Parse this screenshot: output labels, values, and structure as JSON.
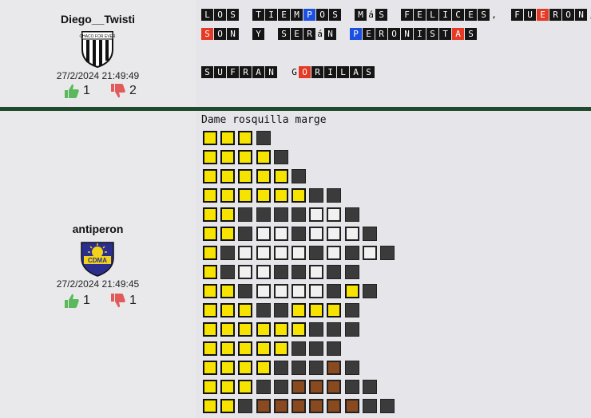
{
  "posts": [
    {
      "username": "Diego__Twisti",
      "badge_text": "CHACO FOR EVER",
      "date": "27/2/2024 21:49:49",
      "likes": "1",
      "dislikes": "2",
      "message_lines": [
        "LOS TIEMPOS MáS FELICES, FUERON,",
        "SON Y SERáN PERONISTAS",
        "",
        "SUFRAN GORILAS"
      ],
      "blue_letters": [
        "P",
        "P"
      ],
      "red_letters": [
        "O",
        "S",
        "A",
        "O"
      ]
    },
    {
      "username": "antiperon",
      "badge_text": "CDMA",
      "date": "27/2/2024 21:49:45",
      "likes": "1",
      "dislikes": "1",
      "caption": "Dame rosquilla marge",
      "art_rows": [
        "yyyd",
        "yyyyd",
        "yyyyyd",
        "yyyyyydd",
        "yyddddwwd",
        "yydwwdwwwd",
        "ydwwwwdwdwd",
        "ydwwddwdd",
        "yydwwwwdyd",
        "yyyddyyyd",
        "yyyyyyddd",
        "yyyyyddd",
        "yyyydddbd",
        "yyyddbbbdd",
        "yydbbbbbbdd"
      ]
    }
  ],
  "colors": {
    "y": "#f7e300",
    "d": "#3b3b3b",
    "w": "#f1f1f1",
    "b": "#8a4a20",
    "like": "#5cb85c",
    "dislike": "#e25b5b"
  }
}
